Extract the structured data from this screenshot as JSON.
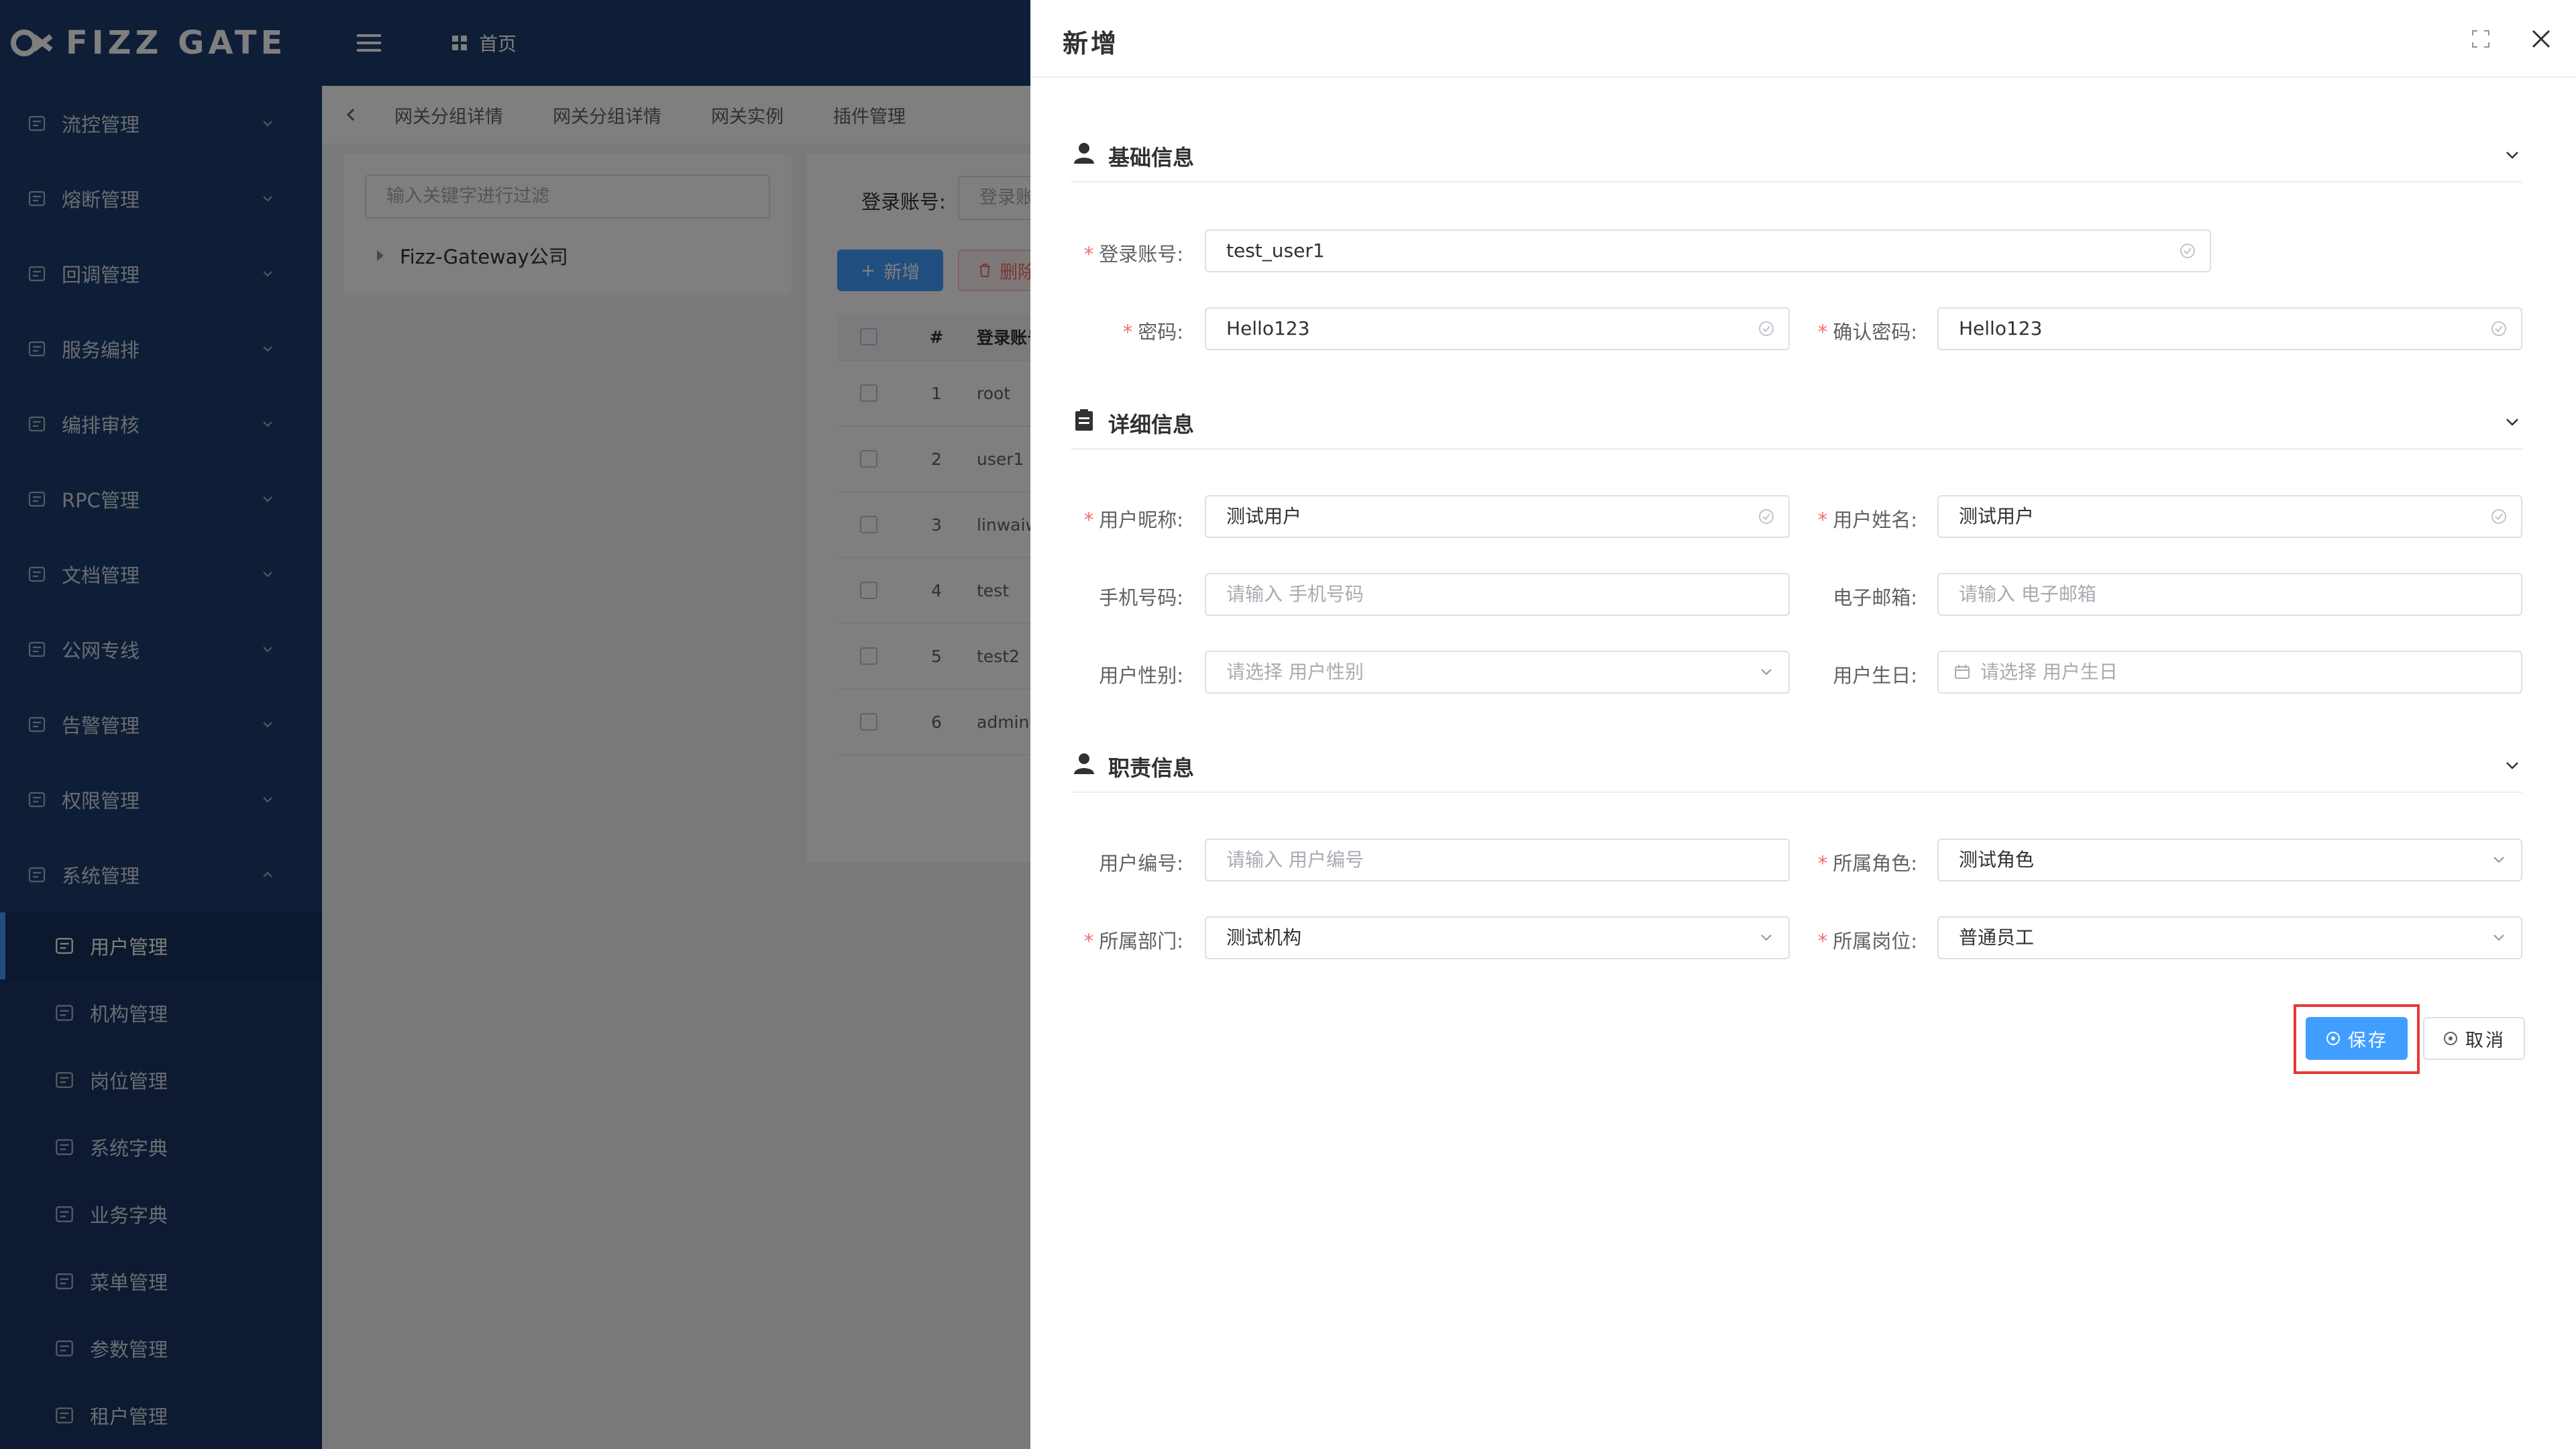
{
  "app": {
    "logo": "FIZZ GATE"
  },
  "topbar": {
    "home": "首页"
  },
  "sidebar": {
    "menus": [
      {
        "label": "流控管理",
        "icon": "org-tree-icon"
      },
      {
        "label": "熔断管理",
        "icon": "table-icon"
      },
      {
        "label": "回调管理",
        "icon": "link-icon"
      },
      {
        "label": "服务编排",
        "icon": "grid-icon"
      },
      {
        "label": "编排审核",
        "icon": "audit-icon"
      },
      {
        "label": "RPC管理",
        "icon": "rpc-icon"
      },
      {
        "label": "文档管理",
        "icon": "doc-icon"
      },
      {
        "label": "公网专线",
        "icon": "network-icon"
      },
      {
        "label": "告警管理",
        "icon": "bell-icon"
      },
      {
        "label": "权限管理",
        "icon": "lock-icon"
      },
      {
        "label": "系统管理",
        "icon": "gear-icon"
      }
    ],
    "submenu": [
      {
        "label": "用户管理",
        "icon": "user-icon",
        "active": true
      },
      {
        "label": "机构管理",
        "icon": "user-icon"
      },
      {
        "label": "岗位管理",
        "icon": "chat-icon"
      },
      {
        "label": "系统字典",
        "icon": "book-icon"
      },
      {
        "label": "业务字典",
        "icon": "book-icon"
      },
      {
        "label": "菜单管理",
        "icon": "org-tree-icon"
      },
      {
        "label": "参数管理",
        "icon": "chat-icon"
      },
      {
        "label": "租户管理",
        "icon": "search-icon"
      }
    ]
  },
  "tabs": [
    "网关分组详情",
    "网关分组详情",
    "网关实例",
    "插件管理"
  ],
  "tree": {
    "placeholder": "输入关键字进行过滤",
    "node": "Fizz-Gateway公司"
  },
  "list": {
    "search_label": "登录账号:",
    "search_placeholder": "登录账号",
    "add_label": "新增",
    "delete_label": "删除",
    "columns": [
      "#",
      "登录账号"
    ],
    "rows": [
      {
        "no": "1",
        "account": "root"
      },
      {
        "no": "2",
        "account": "user1"
      },
      {
        "no": "3",
        "account": "linwaiwai"
      },
      {
        "no": "4",
        "account": "test"
      },
      {
        "no": "5",
        "account": "test2"
      },
      {
        "no": "6",
        "account": "admin"
      }
    ]
  },
  "drawer": {
    "title": "新增",
    "sections": {
      "basic": "基础信息",
      "detail": "详细信息",
      "job": "职责信息"
    },
    "fields": {
      "account": {
        "label": "登录账号:",
        "value": "test_user1"
      },
      "password": {
        "label": "密码:",
        "value": "Hello123"
      },
      "confirm": {
        "label": "确认密码:",
        "value": "Hello123"
      },
      "nickname": {
        "label": "用户昵称:",
        "value": "测试用户"
      },
      "realname": {
        "label": "用户姓名:",
        "value": "测试用户"
      },
      "phone": {
        "label": "手机号码:",
        "placeholder": "请输入 手机号码"
      },
      "email": {
        "label": "电子邮箱:",
        "placeholder": "请输入 电子邮箱"
      },
      "gender": {
        "label": "用户性别:",
        "placeholder": "请选择 用户性别"
      },
      "birthday": {
        "label": "用户生日:",
        "placeholder": "请选择 用户生日"
      },
      "userno": {
        "label": "用户编号:",
        "placeholder": "请输入 用户编号"
      },
      "role": {
        "label": "所属角色:",
        "value": "测试角色"
      },
      "dept": {
        "label": "所属部门:",
        "value": "测试机构"
      },
      "post": {
        "label": "所属岗位:",
        "value": "普通员工"
      }
    },
    "save_label": "保存",
    "cancel_label": "取消"
  },
  "colors": {
    "accent": "#409eff",
    "sidebar": "#1f3d6e",
    "required": "#f56c6c",
    "highlight": "#e53935"
  }
}
